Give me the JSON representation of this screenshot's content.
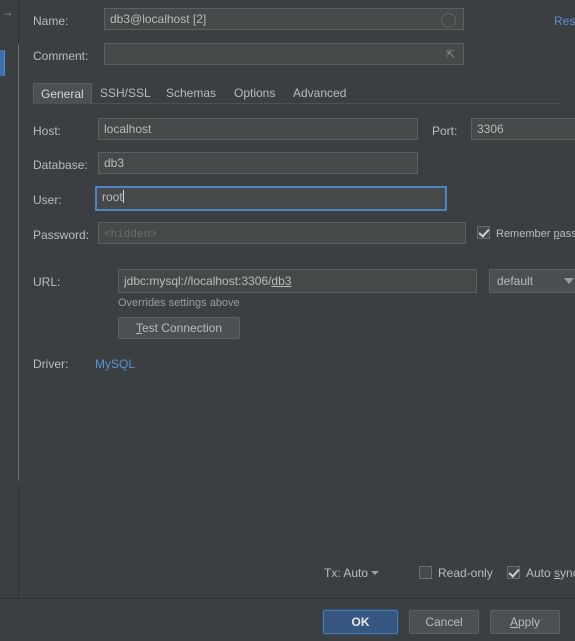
{
  "rail": {
    "arrow_icon": "arrow-right-icon",
    "marker_color": "#3f6fae"
  },
  "header": {
    "name_label": "Name:",
    "name_value": "db3@localhost [2]",
    "name_status_icon": "circle-icon",
    "comment_label": "Comment:",
    "comment_value": "",
    "comment_expand_icon": "expand-icon",
    "reset_label": "Reset"
  },
  "tabs": [
    {
      "label": "General",
      "selected": true
    },
    {
      "label": "SSH/SSL",
      "selected": false
    },
    {
      "label": "Schemas",
      "selected": false
    },
    {
      "label": "Options",
      "selected": false
    },
    {
      "label": "Advanced",
      "selected": false
    }
  ],
  "general": {
    "host_label": "Host:",
    "host_value": "localhost",
    "port_label": "Port:",
    "port_value": "3306",
    "database_label": "Database:",
    "database_value": "db3",
    "user_label": "User:",
    "user_value": "root",
    "password_label": "Password:",
    "password_placeholder": "<hidden>",
    "remember_password_label": "Remember password",
    "remember_password_checked": true,
    "url_label": "URL:",
    "url_prefix": "jdbc:mysql://localhost:3306/",
    "url_suffix": "db3",
    "url_scheme_value": "default",
    "overrides_hint": "Overrides settings above",
    "test_connection_mnemonic": "T",
    "test_connection_rest": "est Connection",
    "driver_label": "Driver:",
    "driver_value": "MySQL"
  },
  "status_bar": {
    "tx_label": "Tx: Auto",
    "tx_chevron_icon": "chevron-down-icon",
    "read_only_label": "Read-only",
    "read_only_checked": false,
    "auto_sync_prefix": "Auto ",
    "auto_sync_mnemonic": "s",
    "auto_sync_rest": "ync",
    "auto_sync_checked": true
  },
  "footer": {
    "ok_label": "OK",
    "cancel_label": "Cancel",
    "apply_mnemonic": "A",
    "apply_rest": "pply"
  },
  "colors": {
    "window_bg": "#3c3f41",
    "field_bg": "#45494a",
    "accent_blue": "#365880",
    "link_blue": "#5a92d6",
    "focus_border": "#4f84c4"
  }
}
